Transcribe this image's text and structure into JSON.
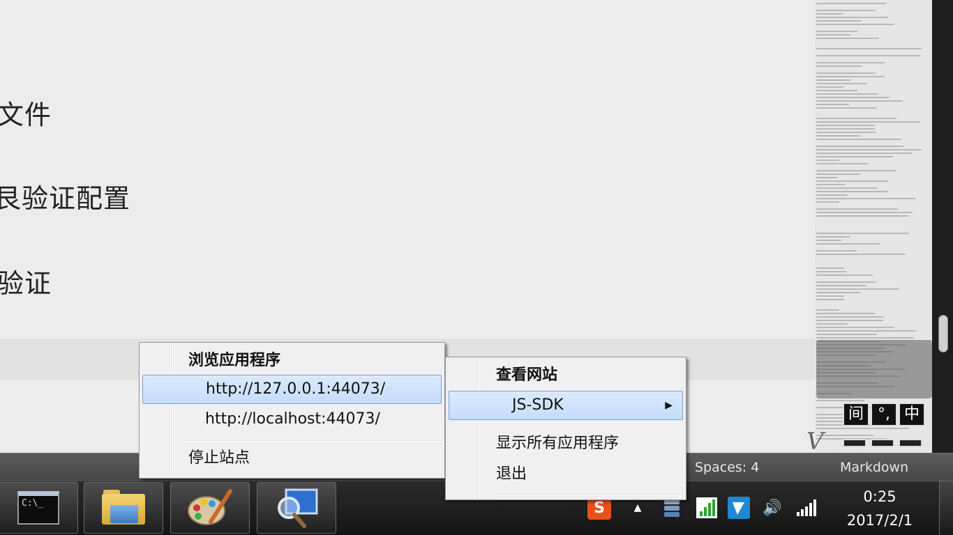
{
  "editor": {
    "lines": [
      "文件",
      "艮验证配置",
      "验证"
    ]
  },
  "statusbar": {
    "spaces": "Spaces: 4",
    "syntax": "Markdown"
  },
  "menu_left": {
    "header": "浏览应用程序",
    "items": [
      "http://127.0.0.1:44073/",
      "http://localhost:44073/"
    ],
    "stop": "停止站点",
    "highlighted_index": 0
  },
  "menu_right": {
    "header": "查看网站",
    "site": "JS-SDK",
    "show_all": "显示所有应用程序",
    "exit": "退出"
  },
  "ime": {
    "buttons": [
      "间",
      "°,",
      "中"
    ]
  },
  "taskbar": {
    "apps": [
      "cmd-icon",
      "file-explorer-icon",
      "paint-icon",
      "remote-desktop-icon"
    ],
    "cmd_prompt_text": "C:\\_"
  },
  "tray": {
    "icons": [
      "sogou-ime-icon",
      "show-hidden-icons-arrow",
      "iis-express-icon",
      "network-signal-icon",
      "tray-app-icon",
      "volume-icon",
      "wifi-icon"
    ],
    "ime_letter": "S",
    "time": "0:25",
    "date": "2017/2/1"
  },
  "colors": {
    "menu_highlight": "#c4ddfc",
    "taskbar": "#1e1e1e",
    "statusbar": "#505050",
    "editor_bg": "#ececec"
  }
}
